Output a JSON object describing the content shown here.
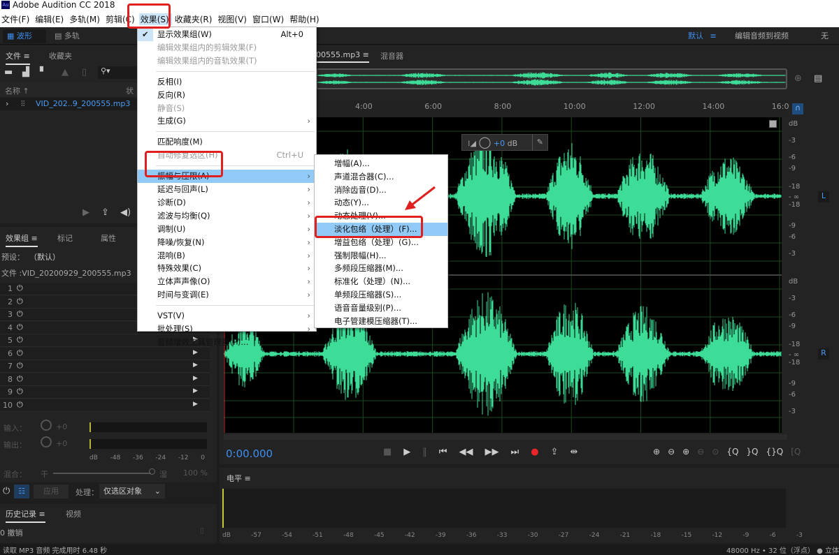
{
  "app": {
    "title": "Adobe Audition CC 2018",
    "logo": "Au"
  },
  "menubar": [
    "文件(F)",
    "编辑(E)",
    "多轨(M)",
    "剪辑(C)",
    "效果(S)",
    "收藏夹(R)",
    "视图(V)",
    "窗口(W)",
    "帮助(H)"
  ],
  "toolbar": {
    "waveform": "波形",
    "multitrack": "多轨",
    "workspace_default": "默认",
    "workspace_edit_video": "编辑音频到视频",
    "workspace_wireless": "无线"
  },
  "files_panel": {
    "tab_files": "文件",
    "tab_favorites": "收藏夹",
    "col_name": "名称",
    "col_status": "状",
    "file": "VID_202..9_200555.mp3"
  },
  "effects_rack": {
    "tab_rack": "效果组",
    "tab_markers": "标记",
    "tab_properties": "属性",
    "preset_label": "预设：",
    "preset_value": "（默认）",
    "file_label": "文件 :VID_20200929_200555.mp3",
    "slots": [
      "1",
      "2",
      "3",
      "4",
      "5",
      "6",
      "7",
      "8",
      "9",
      "10"
    ],
    "input_label": "输入：",
    "output_label": "输出：",
    "input_gain": "+0",
    "output_gain": "+0",
    "meter_ticks": [
      "dB",
      "-48",
      "-36",
      "-24",
      "-12",
      "0"
    ],
    "mix_label": "混合：",
    "mix_dry": "干",
    "mix_wet": "湿",
    "mix_value": "100 %",
    "apply": "应用",
    "process_label": "处理：",
    "process_value": "仅选区对象"
  },
  "history": {
    "tab_history": "历史记录",
    "tab_video": "视频",
    "undo": "0 撤销"
  },
  "editor": {
    "tab_file": "00555.mp3",
    "tab_mixer": "混音器",
    "ruler": [
      "4:00",
      "6:00",
      "8:00",
      "10:00",
      "12:00",
      "14:00",
      "16:0"
    ],
    "hud_gain": "+0",
    "hud_unit": "dB",
    "db_scale": [
      "dB",
      "-3",
      "-6",
      "-9",
      "-18",
      "- ∞",
      "-18",
      "-9",
      "-6",
      "-3"
    ],
    "channel_left": "L",
    "channel_right": "R",
    "time": "0:00.000",
    "waveform_color": "#3ddc97"
  },
  "levels": {
    "title": "电平",
    "ticks": [
      "dB",
      "-57",
      "-54",
      "-51",
      "-48",
      "-45",
      "-42",
      "-39",
      "-36",
      "-33",
      "-30",
      "-27",
      "-24",
      "-21",
      "-18",
      "-15",
      "-12",
      "-9",
      "-6",
      "-3"
    ]
  },
  "status": {
    "left": "读取 MP3 音频 完成用时 6.48 秒",
    "right": "48000 Hz • 32 位（浮点） ● 立体"
  },
  "effects_menu": [
    {
      "label": "显示效果组(W)",
      "shortcut": "Alt+0",
      "checked": true
    },
    {
      "label": "编辑效果组内的剪辑效果(F)",
      "disabled": true
    },
    {
      "label": "编辑效果组内的音轨效果(T)",
      "disabled": true
    },
    {
      "sep": true
    },
    {
      "label": "反相(I)"
    },
    {
      "label": "反向(R)"
    },
    {
      "label": "静音(S)",
      "disabled": true
    },
    {
      "label": "生成(G)",
      "sub": true
    },
    {
      "sep": true
    },
    {
      "label": "匹配响度(M)"
    },
    {
      "label": "自动修复选区(H)",
      "shortcut": "Ctrl+U",
      "disabled": true
    },
    {
      "sep": true
    },
    {
      "label": "振幅与压限(A)",
      "sub": true,
      "highlight": true
    },
    {
      "label": "延迟与回声(L)",
      "sub": true
    },
    {
      "label": "诊断(D)",
      "sub": true
    },
    {
      "label": "滤波与均衡(Q)",
      "sub": true
    },
    {
      "label": "调制(U)",
      "sub": true
    },
    {
      "label": "降噪/恢复(N)",
      "sub": true
    },
    {
      "label": "混响(B)",
      "sub": true
    },
    {
      "label": "特殊效果(C)",
      "sub": true
    },
    {
      "label": "立体声声像(O)",
      "sub": true
    },
    {
      "label": "时间与变调(E)",
      "sub": true
    },
    {
      "sep": true
    },
    {
      "label": "VST(V)",
      "sub": true
    },
    {
      "label": "批处理(S)",
      "sub": true
    },
    {
      "label": "音频增效工具管理器(P)..."
    }
  ],
  "amplitude_submenu": [
    {
      "label": "增幅(A)..."
    },
    {
      "label": "声道混合器(C)..."
    },
    {
      "label": "消除齿音(D)..."
    },
    {
      "label": "动态(Y)..."
    },
    {
      "label": "动态处理(V)..."
    },
    {
      "label": "淡化包络（处理）(F)...",
      "highlight": true
    },
    {
      "label": "增益包络（处理）(G)..."
    },
    {
      "label": "强制限幅(H)..."
    },
    {
      "label": "多频段压缩器(M)..."
    },
    {
      "label": "标准化（处理）(N)..."
    },
    {
      "label": "单频段压缩器(S)..."
    },
    {
      "label": "语音音量级别(P)..."
    },
    {
      "label": "电子管建模压缩器(T)..."
    }
  ],
  "colors": {
    "accent": "#2d8ceb",
    "highlight": "#91c9f7",
    "annotation": "#e02020",
    "record": "#e8262a"
  }
}
